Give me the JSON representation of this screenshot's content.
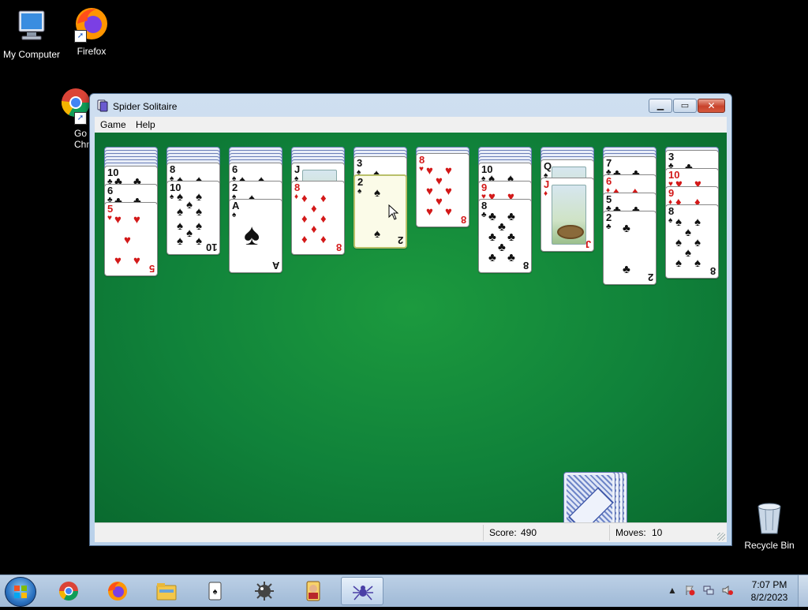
{
  "desktop": {
    "icons": [
      {
        "label": "My Computer"
      },
      {
        "label": "Firefox"
      },
      {
        "label": "Go\nChr"
      },
      {
        "label": "Recycle Bin"
      }
    ]
  },
  "window": {
    "title": "Spider Solitaire",
    "menu": [
      "Game",
      "Help"
    ],
    "status": {
      "score_label": "Score:",
      "score_value": "490",
      "moves_label": "Moves:",
      "moves_value": "10"
    }
  },
  "tableau": [
    {
      "backs": 6,
      "cards": [
        {
          "rank": "10",
          "suit": "clubs"
        },
        {
          "rank": "6",
          "suit": "clubs"
        },
        {
          "rank": "5",
          "suit": "hearts"
        }
      ]
    },
    {
      "backs": 5,
      "cards": [
        {
          "rank": "8",
          "suit": "spades"
        },
        {
          "rank": "10",
          "suit": "spades"
        }
      ]
    },
    {
      "backs": 5,
      "cards": [
        {
          "rank": "6",
          "suit": "spades"
        },
        {
          "rank": "2",
          "suit": "spades"
        },
        {
          "rank": "A",
          "suit": "spades"
        }
      ]
    },
    {
      "backs": 5,
      "cards": [
        {
          "rank": "J",
          "suit": "spades"
        },
        {
          "rank": "8",
          "suit": "diamonds"
        }
      ]
    },
    {
      "backs": 3,
      "cards": [
        {
          "rank": "3",
          "suit": "spades"
        },
        {
          "rank": "2",
          "suit": "spades",
          "selected": true
        }
      ]
    },
    {
      "backs": 2,
      "cards": [
        {
          "rank": "8",
          "suit": "hearts"
        }
      ]
    },
    {
      "backs": 5,
      "cards": [
        {
          "rank": "10",
          "suit": "spades"
        },
        {
          "rank": "9",
          "suit": "hearts"
        },
        {
          "rank": "8",
          "suit": "clubs"
        }
      ]
    },
    {
      "backs": 4,
      "cards": [
        {
          "rank": "Q",
          "suit": "spades"
        },
        {
          "rank": "J",
          "suit": "diamonds"
        }
      ]
    },
    {
      "backs": 3,
      "cards": [
        {
          "rank": "7",
          "suit": "clubs"
        },
        {
          "rank": "6",
          "suit": "diamonds"
        },
        {
          "rank": "5",
          "suit": "clubs"
        },
        {
          "rank": "2",
          "suit": "clubs"
        }
      ]
    },
    {
      "backs": 1,
      "cards": [
        {
          "rank": "3",
          "suit": "clubs"
        },
        {
          "rank": "10",
          "suit": "hearts"
        },
        {
          "rank": "9",
          "suit": "diamonds"
        },
        {
          "rank": "8",
          "suit": "spades"
        }
      ]
    }
  ],
  "stock": {
    "piles": 4
  },
  "taskbar": {
    "apps": [
      "chrome-icon",
      "firefox-icon",
      "file-explorer-icon",
      "solitaire-icon",
      "minesweeper-icon",
      "hearts-icon",
      "spider-solitaire-icon"
    ],
    "active_app": "spider-solitaire-icon",
    "clock_time": "7:07 PM",
    "clock_date": "8/2/2023"
  },
  "colors": {
    "felt": "#10823a",
    "red_suit": "#d31919",
    "black_suit": "#111111"
  }
}
